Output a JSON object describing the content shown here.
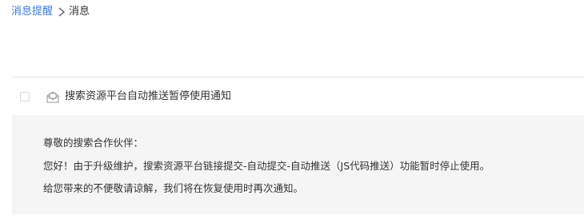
{
  "breadcrumb": {
    "parent": "消息提醒",
    "current": "消息"
  },
  "message": {
    "title": "搜索资源平台自动推送暂停使用通知",
    "body": {
      "greeting": "尊敬的搜索合作伙伴：",
      "line1": "您好！由于升级维护，搜索资源平台链接提交-自动提交-自动推送（JS代码推送）功能暂时停止使用。",
      "line2": "给您带来的不便敬请谅解，我们将在恢复使用时再次通知。"
    }
  },
  "colors": {
    "link": "#3b7bd6",
    "text": "#333333",
    "body_bg": "#f5f5f5",
    "divider": "#e6e6e6"
  },
  "icons": {
    "separator": "chevron-right-icon",
    "message": "envelope-open-icon"
  }
}
